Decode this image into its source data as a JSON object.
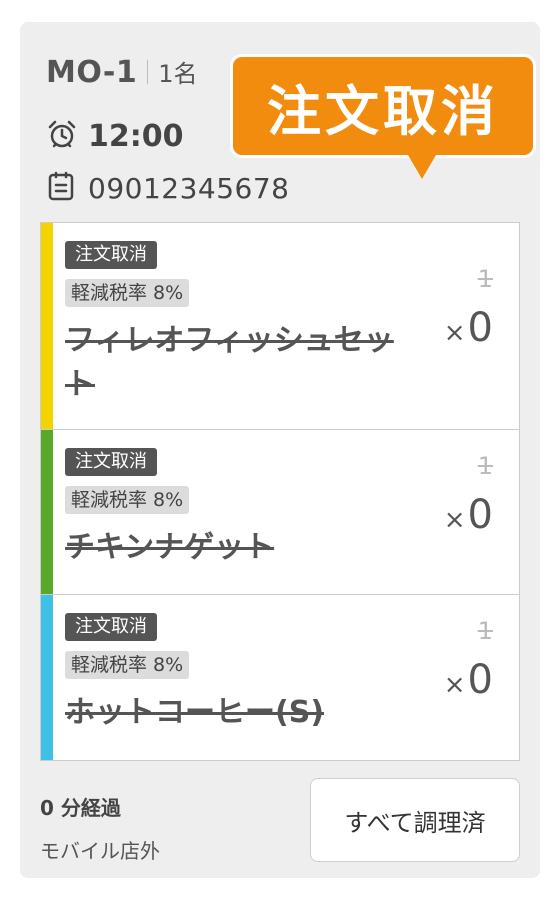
{
  "order": {
    "id": "MO-1",
    "people": "1名",
    "time": "12:00",
    "phone": "09012345678"
  },
  "callout": {
    "text": "注文取消",
    "color": "#f28c0f"
  },
  "items": [
    {
      "status": "注文取消",
      "tax": "軽減税率 8%",
      "name": "フィレオフィッシュセット",
      "original_qty": "1",
      "qty_prefix": "×",
      "qty": "0",
      "color": "#f5d300"
    },
    {
      "status": "注文取消",
      "tax": "軽減税率 8%",
      "name": "チキンナゲット",
      "original_qty": "1",
      "qty_prefix": "×",
      "qty": "0",
      "color": "#5aa82a"
    },
    {
      "status": "注文取消",
      "tax": "軽減税率 8%",
      "name": "ホットコーヒー(S)",
      "original_qty": "1",
      "qty_prefix": "×",
      "qty": "0",
      "color": "#3fc0e6"
    }
  ],
  "footer": {
    "elapsed_value": "0",
    "elapsed_label": "分経過",
    "location": "モバイル店外",
    "done_button": "すべて調理済"
  },
  "icons": {
    "time": "alarm-clock-icon",
    "phone": "clipboard-icon"
  }
}
